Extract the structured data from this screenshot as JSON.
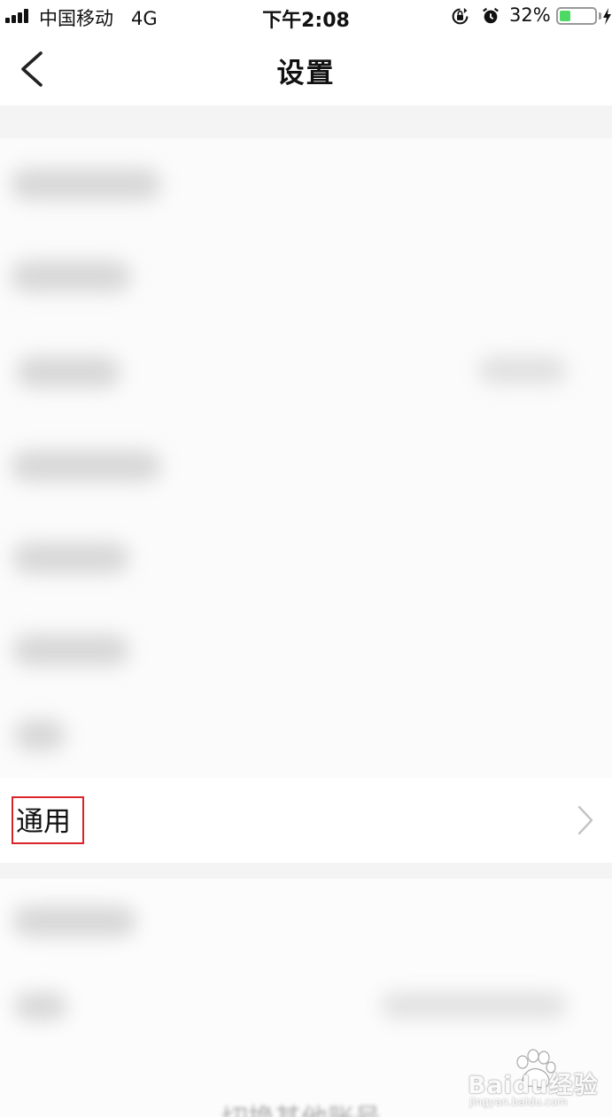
{
  "status_bar": {
    "carrier": "中国移动",
    "network": "4G",
    "time": "下午2:08",
    "battery_percent": "32%",
    "battery_level": 0.32
  },
  "nav": {
    "title": "设置"
  },
  "settings": {
    "general_label": "通用"
  },
  "bottom_partial_text": "切换其他账号",
  "watermark": {
    "logo": "Baidu经验",
    "domain": "jingyan.baidu.com"
  },
  "colors": {
    "highlight": "#d9242a",
    "battery_fill": "#4cd964"
  },
  "icons": [
    "signal-icon",
    "back-arrow-icon",
    "rotation-lock-icon",
    "alarm-icon",
    "battery-icon",
    "charging-bolt-icon",
    "chevron-right-icon",
    "baidu-paw-icon"
  ]
}
